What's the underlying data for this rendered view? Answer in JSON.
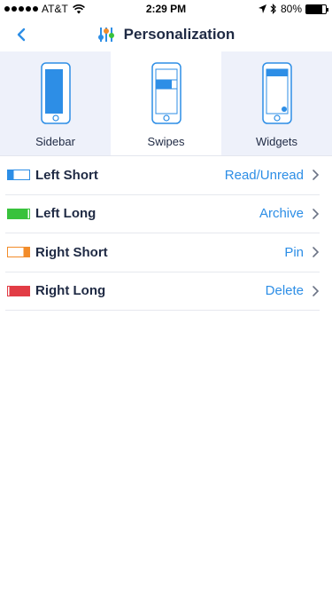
{
  "status_bar": {
    "carrier": "AT&T",
    "time": "2:29 PM",
    "battery": "80%",
    "battery_level": 0.8
  },
  "header": {
    "title": "Personalization",
    "back_icon": "chevron-left-icon",
    "title_icon": "sliders-icon"
  },
  "tabs": [
    {
      "label": "Sidebar",
      "active": false
    },
    {
      "label": "Swipes",
      "active": true
    },
    {
      "label": "Widgets",
      "active": false
    }
  ],
  "swipes": [
    {
      "label": "Left Short",
      "value": "Read/Unread",
      "color": "#2d8ee6"
    },
    {
      "label": "Left Long",
      "value": "Archive",
      "color": "#38c23c"
    },
    {
      "label": "Right Short",
      "value": "Pin",
      "color": "#f28c2a"
    },
    {
      "label": "Right Long",
      "value": "Delete",
      "color": "#e23c45"
    }
  ],
  "colors": {
    "accent": "#2d8ee6",
    "text": "#1f2a44",
    "tab_bg": "#eef1fa"
  }
}
